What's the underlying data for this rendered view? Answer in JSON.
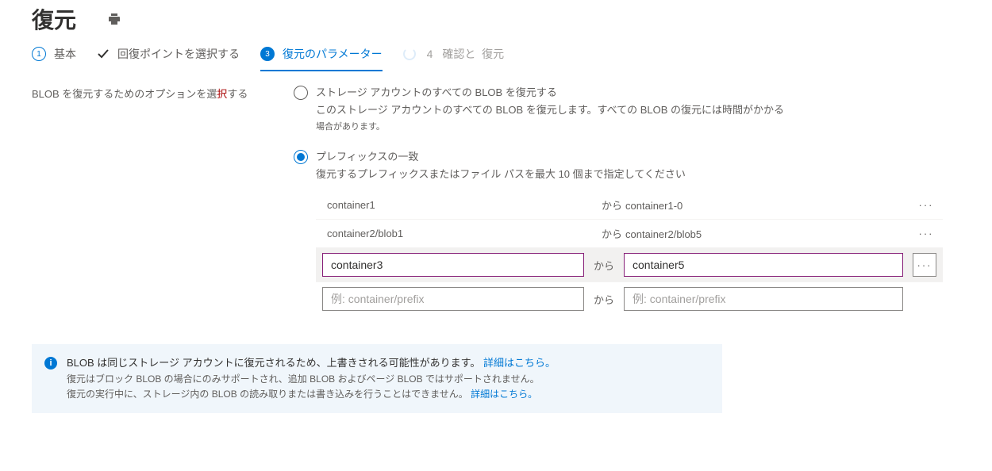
{
  "header": {
    "title": "復元"
  },
  "wizard": {
    "step1": {
      "num": "1",
      "label": "基本"
    },
    "step2": {
      "label": "回復ポイントを選択する"
    },
    "step3": {
      "num": "3",
      "label": "復元のパラメーター"
    },
    "step4": {
      "num": "4",
      "label_a": "確認と",
      "label_b": "復元"
    }
  },
  "form": {
    "option_label_a": "BLOB を復元するためのオプションを選",
    "option_label_req": "択",
    "option_label_b": "する",
    "opt_all": {
      "title": "ストレージ アカウントのすべての BLOB を復元する",
      "desc": "このストレージ アカウントのすべての BLOB を復元します。すべての BLOB の復元には時間がかかる",
      "subnote": "場合があります。"
    },
    "opt_prefix": {
      "title": "プレフィックスの一致",
      "desc": "復元するプレフィックスまたはファイル パスを最大 10 個まで指定してください"
    }
  },
  "prefix": {
    "rows": [
      {
        "from": "container1",
        "to_label": "から",
        "to": "container1-0"
      },
      {
        "from": "container2/blob1",
        "to_label": "から",
        "to": "container2/blob5"
      }
    ],
    "edit": {
      "from": "container3",
      "sep": "から",
      "to": "container5"
    },
    "new": {
      "from_ph": "例: container/prefix",
      "sep": "から",
      "to_ph": "例: container/prefix"
    },
    "dots": "···"
  },
  "info": {
    "l1_a": "BLOB は同じストレージ アカウントに復元されるため、上書きされる可能性があります。",
    "l1_link": "詳細はこちら。",
    "l2": "復元はブロック BLOB の場合にのみサポートされ、追加 BLOB およびページ BLOB ではサポートされません。",
    "l3_a": "復元の実行中に、ストレージ内の BLOB の読み取りまたは書き込みを行うことはできません。",
    "l3_link": "詳細はこちら。"
  }
}
